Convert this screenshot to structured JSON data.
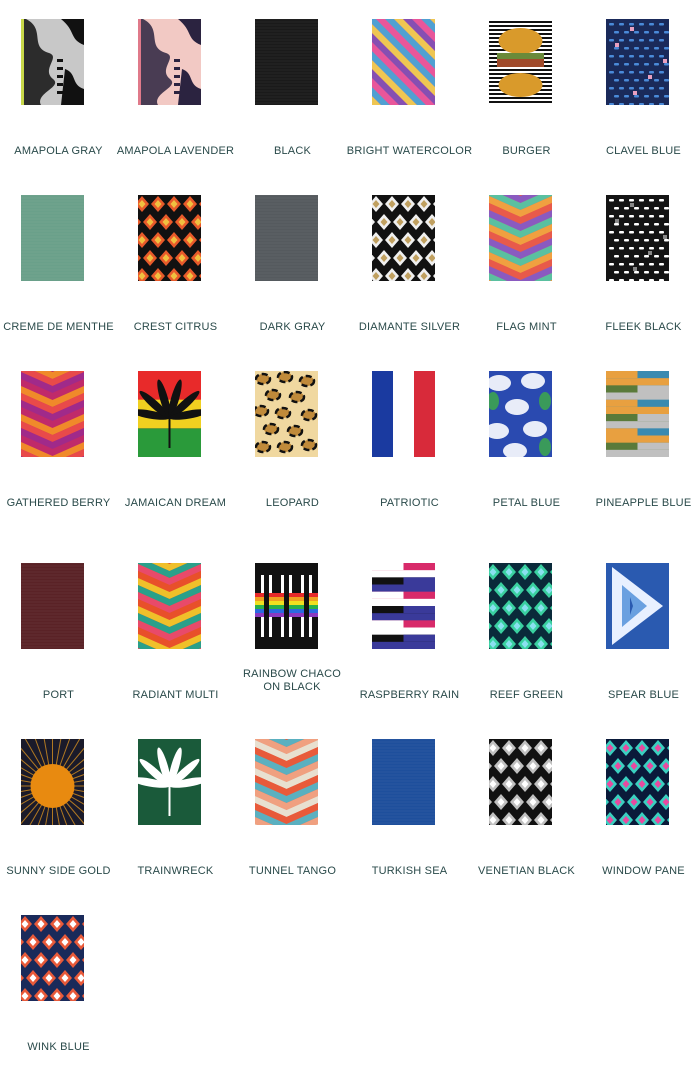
{
  "colors": {
    "label_text": "#2a4a4a",
    "background": "#ffffff"
  },
  "swatches": [
    {
      "label": "AMAPOLA GRAY",
      "pattern": "amapola",
      "colors": [
        "#c8c8c8",
        "#111111",
        "#c8d84a"
      ]
    },
    {
      "label": "AMAPOLA LAVENDER",
      "pattern": "amapola",
      "colors": [
        "#f2c9c4",
        "#2b2340",
        "#e07a8a"
      ]
    },
    {
      "label": "BLACK",
      "pattern": "solid",
      "colors": [
        "#1a1a1a"
      ]
    },
    {
      "label": "BRIGHT WATERCOLOR",
      "pattern": "diagonal",
      "colors": [
        "#e8569a",
        "#3fa9d8",
        "#f0d34a",
        "#7b4fb5"
      ]
    },
    {
      "label": "BURGER",
      "pattern": "burger",
      "colors": [
        "#111111",
        "#ffffff",
        "#d99a2b",
        "#6a8a3a",
        "#a04a2a"
      ]
    },
    {
      "label": "CLAVEL BLUE",
      "pattern": "dots",
      "colors": [
        "#1a2a5a",
        "#4a8ad8",
        "#e8a0c0"
      ]
    },
    {
      "label": "CREME DE MENTHE",
      "pattern": "solid",
      "colors": [
        "#6aa08a"
      ]
    },
    {
      "label": "CREST CITRUS",
      "pattern": "diamond",
      "colors": [
        "#111111",
        "#e85a2a",
        "#f0c040"
      ]
    },
    {
      "label": "DARK GRAY",
      "pattern": "solid",
      "colors": [
        "#555a5e"
      ]
    },
    {
      "label": "DIAMANTE SILVER",
      "pattern": "diamond",
      "colors": [
        "#111111",
        "#f0f0f0",
        "#c0a060"
      ]
    },
    {
      "label": "FLAG MINT",
      "pattern": "chevron",
      "colors": [
        "#e85a4a",
        "#8a5ac0",
        "#5ac0a0",
        "#f0a040"
      ]
    },
    {
      "label": "FLEEK BLACK",
      "pattern": "dots",
      "colors": [
        "#141414",
        "#ffffff",
        "#888888"
      ]
    },
    {
      "label": "GATHERED BERRY",
      "pattern": "chevron",
      "colors": [
        "#c02a6a",
        "#f08a2a",
        "#e84a4a",
        "#a02a8a"
      ]
    },
    {
      "label": "JAMAICAN DREAM",
      "pattern": "leaf",
      "colors": [
        "#e82a2a",
        "#f0d020",
        "#2a9a3a",
        "#111111"
      ]
    },
    {
      "label": "LEOPARD",
      "pattern": "leopard",
      "colors": [
        "#f0d8a0",
        "#111111",
        "#c08a3a"
      ]
    },
    {
      "label": "PATRIOTIC",
      "pattern": "vstripes",
      "colors": [
        "#1a3aa0",
        "#ffffff",
        "#d82a3a"
      ]
    },
    {
      "label": "PETAL BLUE",
      "pattern": "petal",
      "colors": [
        "#2a4ab0",
        "#e8ecf8",
        "#3a9a5a"
      ]
    },
    {
      "label": "PINEAPPLE BLUE",
      "pattern": "hstripes",
      "colors": [
        "#3a8ab0",
        "#e8a040",
        "#5a7a3a",
        "#c0c0c0"
      ]
    },
    {
      "label": "PORT",
      "pattern": "solid",
      "colors": [
        "#5a2226"
      ]
    },
    {
      "label": "RADIANT MULTI",
      "pattern": "chevron",
      "colors": [
        "#e8502a",
        "#f0c02a",
        "#2aa08a",
        "#e84a6a"
      ]
    },
    {
      "label": "RAINBOW CHACO ON BLACK",
      "pattern": "rainbow",
      "colors": [
        "#111111",
        "#e82a2a",
        "#f0a020",
        "#f0e020",
        "#2ab04a",
        "#2a6ae0",
        "#8a3ac0"
      ]
    },
    {
      "label": "RASPBERRY RAIN",
      "pattern": "hstripes",
      "colors": [
        "#d82a6a",
        "#ffffff",
        "#111111",
        "#3a3a9a"
      ]
    },
    {
      "label": "REEF GREEN",
      "pattern": "diamond",
      "colors": [
        "#0a2a3a",
        "#3ad0a0",
        "#8ae0f0"
      ]
    },
    {
      "label": "SPEAR BLUE",
      "pattern": "triangle",
      "colors": [
        "#2a5ab0",
        "#e8f0ff",
        "#6aa0e0"
      ]
    },
    {
      "label": "SUNNY SIDE GOLD",
      "pattern": "sun",
      "colors": [
        "#1a1a2a",
        "#f0a020",
        "#e88a10"
      ]
    },
    {
      "label": "TRAINWRECK",
      "pattern": "leaf",
      "colors": [
        "#1a5a3a",
        "#1a5a3a",
        "#1a5a3a",
        "#ffffff"
      ]
    },
    {
      "label": "TUNNEL TANGO",
      "pattern": "chevron",
      "colors": [
        "#e85a3a",
        "#5ab0c0",
        "#f0a080",
        "#e8e0d0"
      ]
    },
    {
      "label": "TURKISH SEA",
      "pattern": "solid",
      "colors": [
        "#1e4f9c"
      ]
    },
    {
      "label": "VENETIAN BLACK",
      "pattern": "diamond",
      "colors": [
        "#111111",
        "#c0c0c0",
        "#ffffff"
      ]
    },
    {
      "label": "WINDOW PANE",
      "pattern": "diamond",
      "colors": [
        "#0a1a3a",
        "#3ad0c0",
        "#e84aa0"
      ]
    },
    {
      "label": "WINK BLUE",
      "pattern": "diamond",
      "colors": [
        "#1a2a5a",
        "#e85a3a",
        "#ffffff"
      ]
    }
  ]
}
